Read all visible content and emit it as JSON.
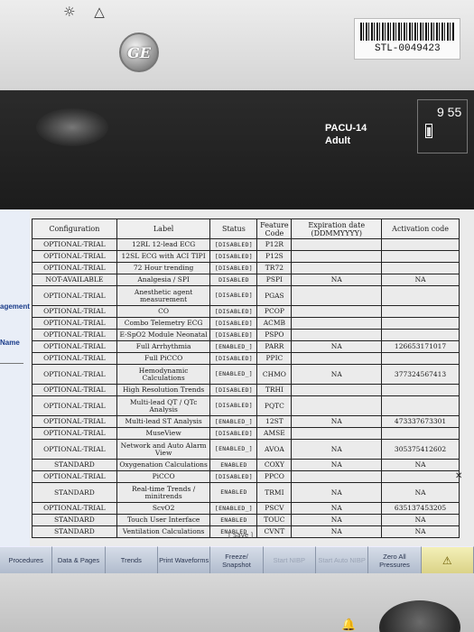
{
  "device": {
    "top_icons": "☼ △",
    "logo": "GE",
    "asset_tag": "STL-0049423"
  },
  "patient": {
    "bed": "PACU-14",
    "mode": "Adult",
    "clock": "9 55"
  },
  "sidebar": {
    "labels": [
      "agement",
      "Name"
    ]
  },
  "table": {
    "headers": [
      "Configuration",
      "Label",
      "Status",
      "Feature Code",
      "Expiration date (DDMMYYYY)",
      "Activation code"
    ],
    "rows": [
      {
        "config": "OPTIONAL-TRIAL",
        "label": "12RL 12-lead ECG",
        "status": "[DISABLED]",
        "code": "P12R",
        "exp": "",
        "act": ""
      },
      {
        "config": "OPTIONAL-TRIAL",
        "label": "12SL ECG with ACI TIPI",
        "status": "[DISABLED]",
        "code": "P12S",
        "exp": "",
        "act": ""
      },
      {
        "config": "OPTIONAL-TRIAL",
        "label": "72 Hour trending",
        "status": "[DISABLED]",
        "code": "TR72",
        "exp": "",
        "act": ""
      },
      {
        "config": "NOT-AVAILABLE",
        "label": "Analgesia / SPI",
        "status": "DISABLED",
        "code": "PSPI",
        "exp": "NA",
        "act": "NA"
      },
      {
        "config": "OPTIONAL-TRIAL",
        "label": "Anesthetic agent measurement",
        "status": "[DISABLED]",
        "code": "PGAS",
        "exp": "",
        "act": "",
        "tall": true
      },
      {
        "config": "OPTIONAL-TRIAL",
        "label": "CO",
        "status": "[DISABLED]",
        "code": "PCOP",
        "exp": "",
        "act": ""
      },
      {
        "config": "OPTIONAL-TRIAL",
        "label": "Combo Telemetry ECG",
        "status": "[DISABLED]",
        "code": "ACMB",
        "exp": "",
        "act": ""
      },
      {
        "config": "OPTIONAL-TRIAL",
        "label": "E-SpO2 Module Neonatal",
        "status": "[DISABLED]",
        "code": "PSPO",
        "exp": "",
        "act": ""
      },
      {
        "config": "OPTIONAL-TRIAL",
        "label": "Full Arrhythmia",
        "status": "[ENABLED_]",
        "code": "PARR",
        "exp": "NA",
        "act": "126653171017"
      },
      {
        "config": "OPTIONAL-TRIAL",
        "label": "Full PiCCO",
        "status": "[DISABLED]",
        "code": "PPIC",
        "exp": "",
        "act": ""
      },
      {
        "config": "OPTIONAL-TRIAL",
        "label": "Hemodynamic Calculations",
        "status": "[ENABLED_]",
        "code": "CHMO",
        "exp": "NA",
        "act": "377324567413",
        "tall": true
      },
      {
        "config": "OPTIONAL-TRIAL",
        "label": "High Resolution Trends",
        "status": "[DISABLED]",
        "code": "TRHI",
        "exp": "",
        "act": ""
      },
      {
        "config": "OPTIONAL-TRIAL",
        "label": "Multi-lead QT / QTc Analysis",
        "status": "[DISABLED]",
        "code": "PQTC",
        "exp": "",
        "act": "",
        "tall": true
      },
      {
        "config": "OPTIONAL-TRIAL",
        "label": "Multi-lead ST Analysis",
        "status": "[ENABLED_]",
        "code": "12ST",
        "exp": "NA",
        "act": "473337673301"
      },
      {
        "config": "OPTIONAL-TRIAL",
        "label": "MuseView",
        "status": "[DISABLED]",
        "code": "AMSE",
        "exp": "",
        "act": ""
      },
      {
        "config": "OPTIONAL-TRIAL",
        "label": "Network and Auto Alarm View",
        "status": "[ENABLED_]",
        "code": "AVOA",
        "exp": "NA",
        "act": "305375412602",
        "tall": true
      },
      {
        "config": "STANDARD",
        "label": "Oxygenation Calculations",
        "status": "ENABLED",
        "code": "COXY",
        "exp": "NA",
        "act": "NA"
      },
      {
        "config": "OPTIONAL-TRIAL",
        "label": "PiCCO",
        "status": "[DISABLED]",
        "code": "PPCO",
        "exp": "",
        "act": ""
      },
      {
        "config": "STANDARD",
        "label": "Real-time Trends / minitrends",
        "status": "ENABLED",
        "code": "TRMI",
        "exp": "NA",
        "act": "NA",
        "tall": true
      },
      {
        "config": "OPTIONAL-TRIAL",
        "label": "ScvO2",
        "status": "[ENABLED_]",
        "code": "PSCV",
        "exp": "NA",
        "act": "635137453205"
      },
      {
        "config": "STANDARD",
        "label": "Touch User Interface",
        "status": "ENABLED",
        "code": "TOUC",
        "exp": "NA",
        "act": "NA"
      },
      {
        "config": "STANDARD",
        "label": "Ventilation Calculations",
        "status": "ENABLED",
        "code": "CVNT",
        "exp": "NA",
        "act": "NA"
      }
    ],
    "save_label": "[ Save ]"
  },
  "toolbar": {
    "buttons": [
      {
        "label": "Procedures",
        "dim": false
      },
      {
        "label": "Data & Pages",
        "dim": false
      },
      {
        "label": "Trends",
        "dim": false
      },
      {
        "label": "Print Waveforms",
        "dim": false
      },
      {
        "label": "Freeze/ Snapshot",
        "dim": false
      },
      {
        "label": "Start NIBP",
        "dim": true
      },
      {
        "label": "Start Auto NIBP",
        "dim": true
      },
      {
        "label": "Zero All Pressures",
        "dim": false
      },
      {
        "label": "⚠",
        "dim": false,
        "alarm": true
      }
    ]
  },
  "bezel": {
    "alarm_light": "🔔"
  }
}
